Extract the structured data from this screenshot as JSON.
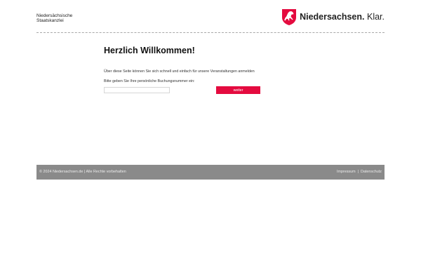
{
  "header": {
    "org_line1": "Niedersächsische",
    "org_line2": "Staatskanzlei",
    "brand_name": "Niedersachsen.",
    "brand_claim": "Klar.",
    "logo_icon": "horse-crest-icon",
    "brand_color": "#e40b3f"
  },
  "main": {
    "title": "Herzlich Willkommen!",
    "intro": "Über diese Seite können Sie sich schnell und einfach für unsere Veranstaltungen anmelden",
    "prompt": "Bitte geben Sie Ihre persönliche Buchungsnummer ein:",
    "booking_input_value": "",
    "submit_label": "weiter",
    "submit_color": "#e40b3f"
  },
  "footer": {
    "copyright": "© 2024 Niedersachsen.de | Alle Rechte vorbehalten",
    "impressum": "Impressum",
    "separator": "|",
    "datenschutz": "Datenschutz",
    "background": "#8a8a8a"
  }
}
